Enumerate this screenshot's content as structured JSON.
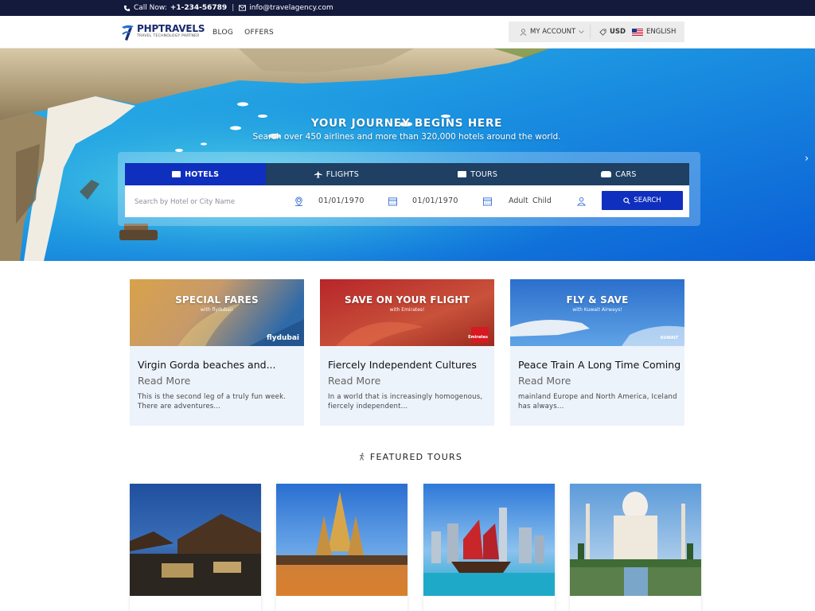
{
  "topbar": {
    "phone_prefix": "Call Now:",
    "phone": "+1-234-56789",
    "separator": "|",
    "email": "info@travelagency.com"
  },
  "header": {
    "logo_text": "PHPTRAVELS",
    "logo_tagline": "TRAVEL TECHNOLOGY PARTNER",
    "nav": [
      "BLOG",
      "OFFERS"
    ],
    "account_label": "MY ACCOUNT",
    "currency": "USD",
    "language": "ENGLISH"
  },
  "hero": {
    "title": "YOUR JOURNEY BEGINS HERE",
    "subtitle": "Search over 450 airlines and more than 320,000 hotels around the world."
  },
  "search": {
    "tabs": [
      {
        "label": "HOTELS",
        "icon": "bed-icon",
        "active": true
      },
      {
        "label": "FLIGHTS",
        "icon": "plane-icon",
        "active": false
      },
      {
        "label": "TOURS",
        "icon": "suitcase-icon",
        "active": false
      },
      {
        "label": "CARS",
        "icon": "car-icon",
        "active": false
      }
    ],
    "placeholder": "Search by Hotel or City Name",
    "checkin": "01/01/1970",
    "checkout": "01/01/1970",
    "guests_adult": "Adult",
    "guests_child": "Child",
    "button": "SEARCH"
  },
  "promos": [
    {
      "banner_title": "SPECIAL FARES",
      "banner_sub": "with flydubai!",
      "brand": "flydubai",
      "title": "Virgin Gorda beaches and...",
      "more": "Read More",
      "text": "This is the second leg of a truly fun week. There are adventures..."
    },
    {
      "banner_title": "SAVE ON YOUR FLIGHT",
      "banner_sub": "with Emirates!",
      "brand": "Emirates",
      "title": "Fiercely Independent Cultures",
      "more": "Read More",
      "text": "In a world that is increasingly homogenous, fiercely independent..."
    },
    {
      "banner_title": "FLY & SAVE",
      "banner_sub": "with Kuwait Airways!",
      "brand": "KUWAIT",
      "title": "Peace Train A Long Time Coming",
      "more": "Read More",
      "text": " mainland Europe and North America, Iceland has always..."
    }
  ],
  "featured": {
    "heading": "FEATURED TOURS"
  },
  "colors": {
    "topbar": "#131a3c",
    "primary": "#0f2fbe",
    "tabs_bg": "#1f3f63",
    "card_bg": "#edf3fb"
  }
}
